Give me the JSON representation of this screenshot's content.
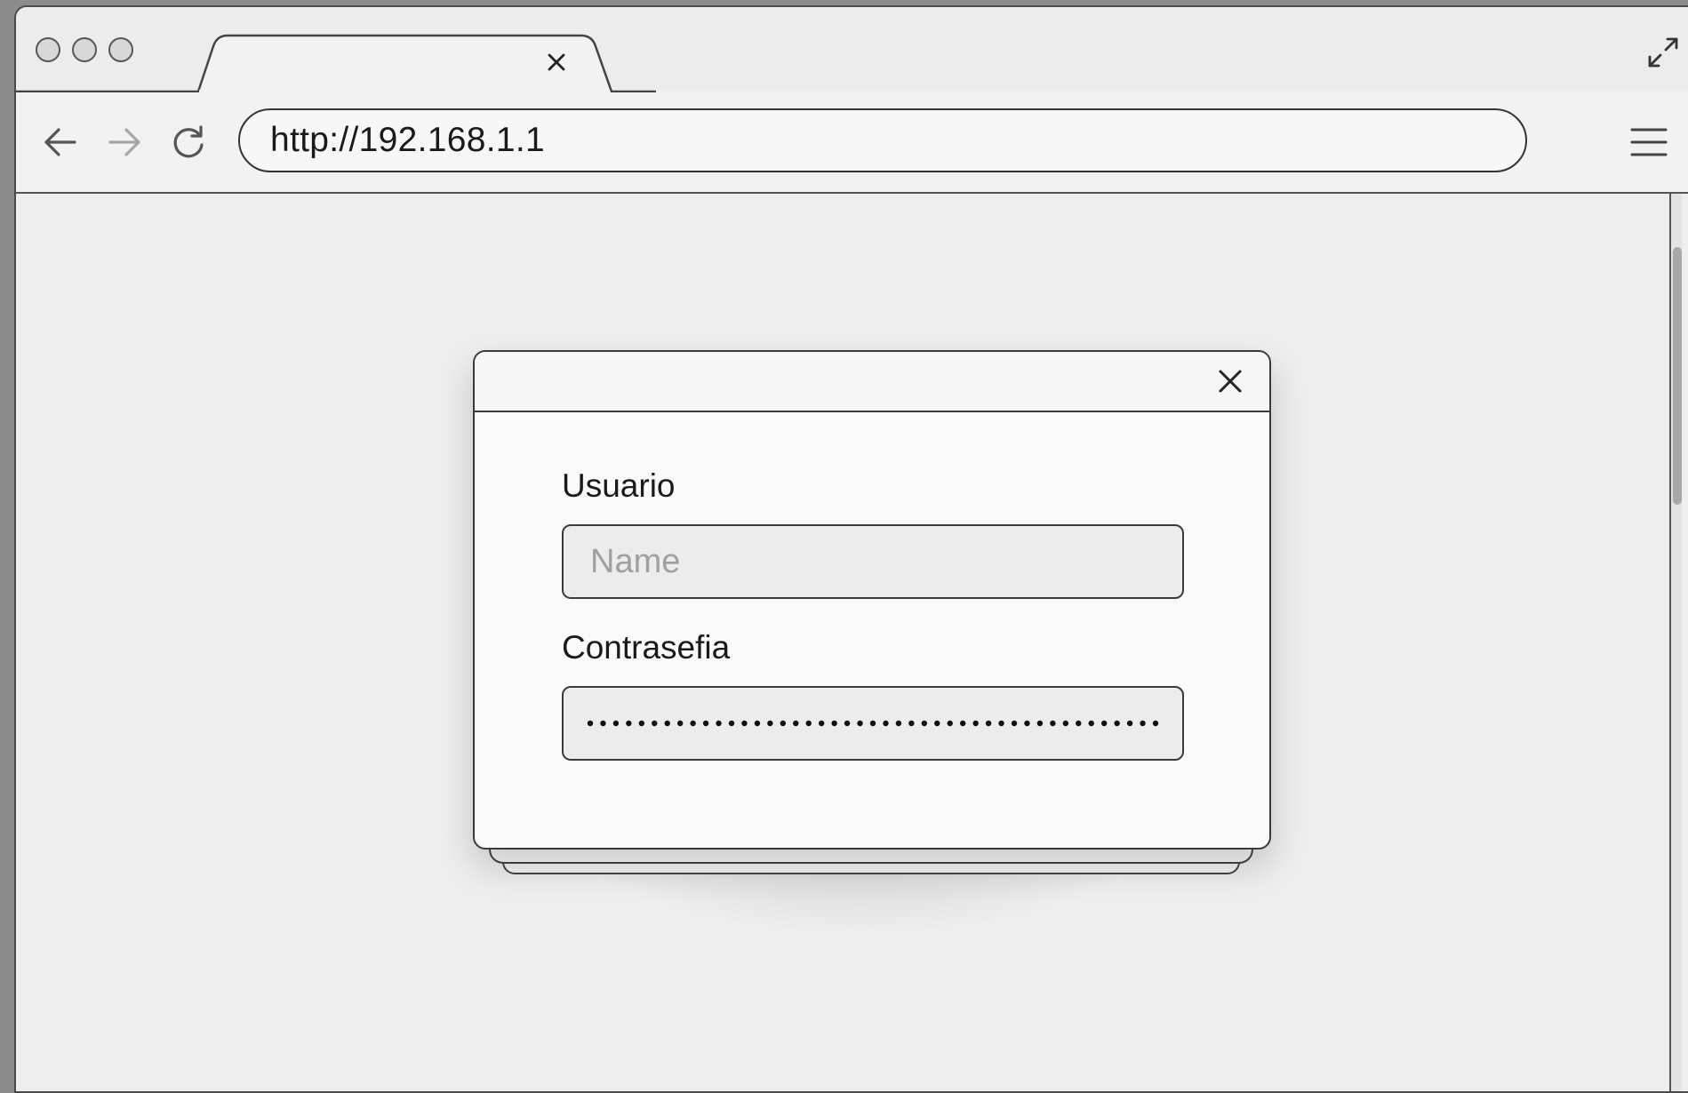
{
  "browser": {
    "address_url": "http://192.168.1.1",
    "tab": {
      "title": "",
      "close_icon": "close-icon"
    },
    "icons": {
      "back": "arrow-left-icon",
      "forward": "arrow-right-icon",
      "reload": "reload-icon",
      "menu": "hamburger-menu-icon",
      "expand": "expand-icon"
    },
    "forward_enabled": false
  },
  "login_dialog": {
    "username": {
      "label": "Usuario",
      "placeholder": "Name",
      "value": ""
    },
    "password": {
      "label": "Contrasefia",
      "masked_length": 45
    },
    "close_icon": "close-icon"
  },
  "colors": {
    "window_border": "#4a4a4a",
    "page_background": "#eeeeee",
    "input_background": "#ececec",
    "placeholder_text": "#a0a0a0",
    "forward_disabled": "#a6a6a6"
  }
}
